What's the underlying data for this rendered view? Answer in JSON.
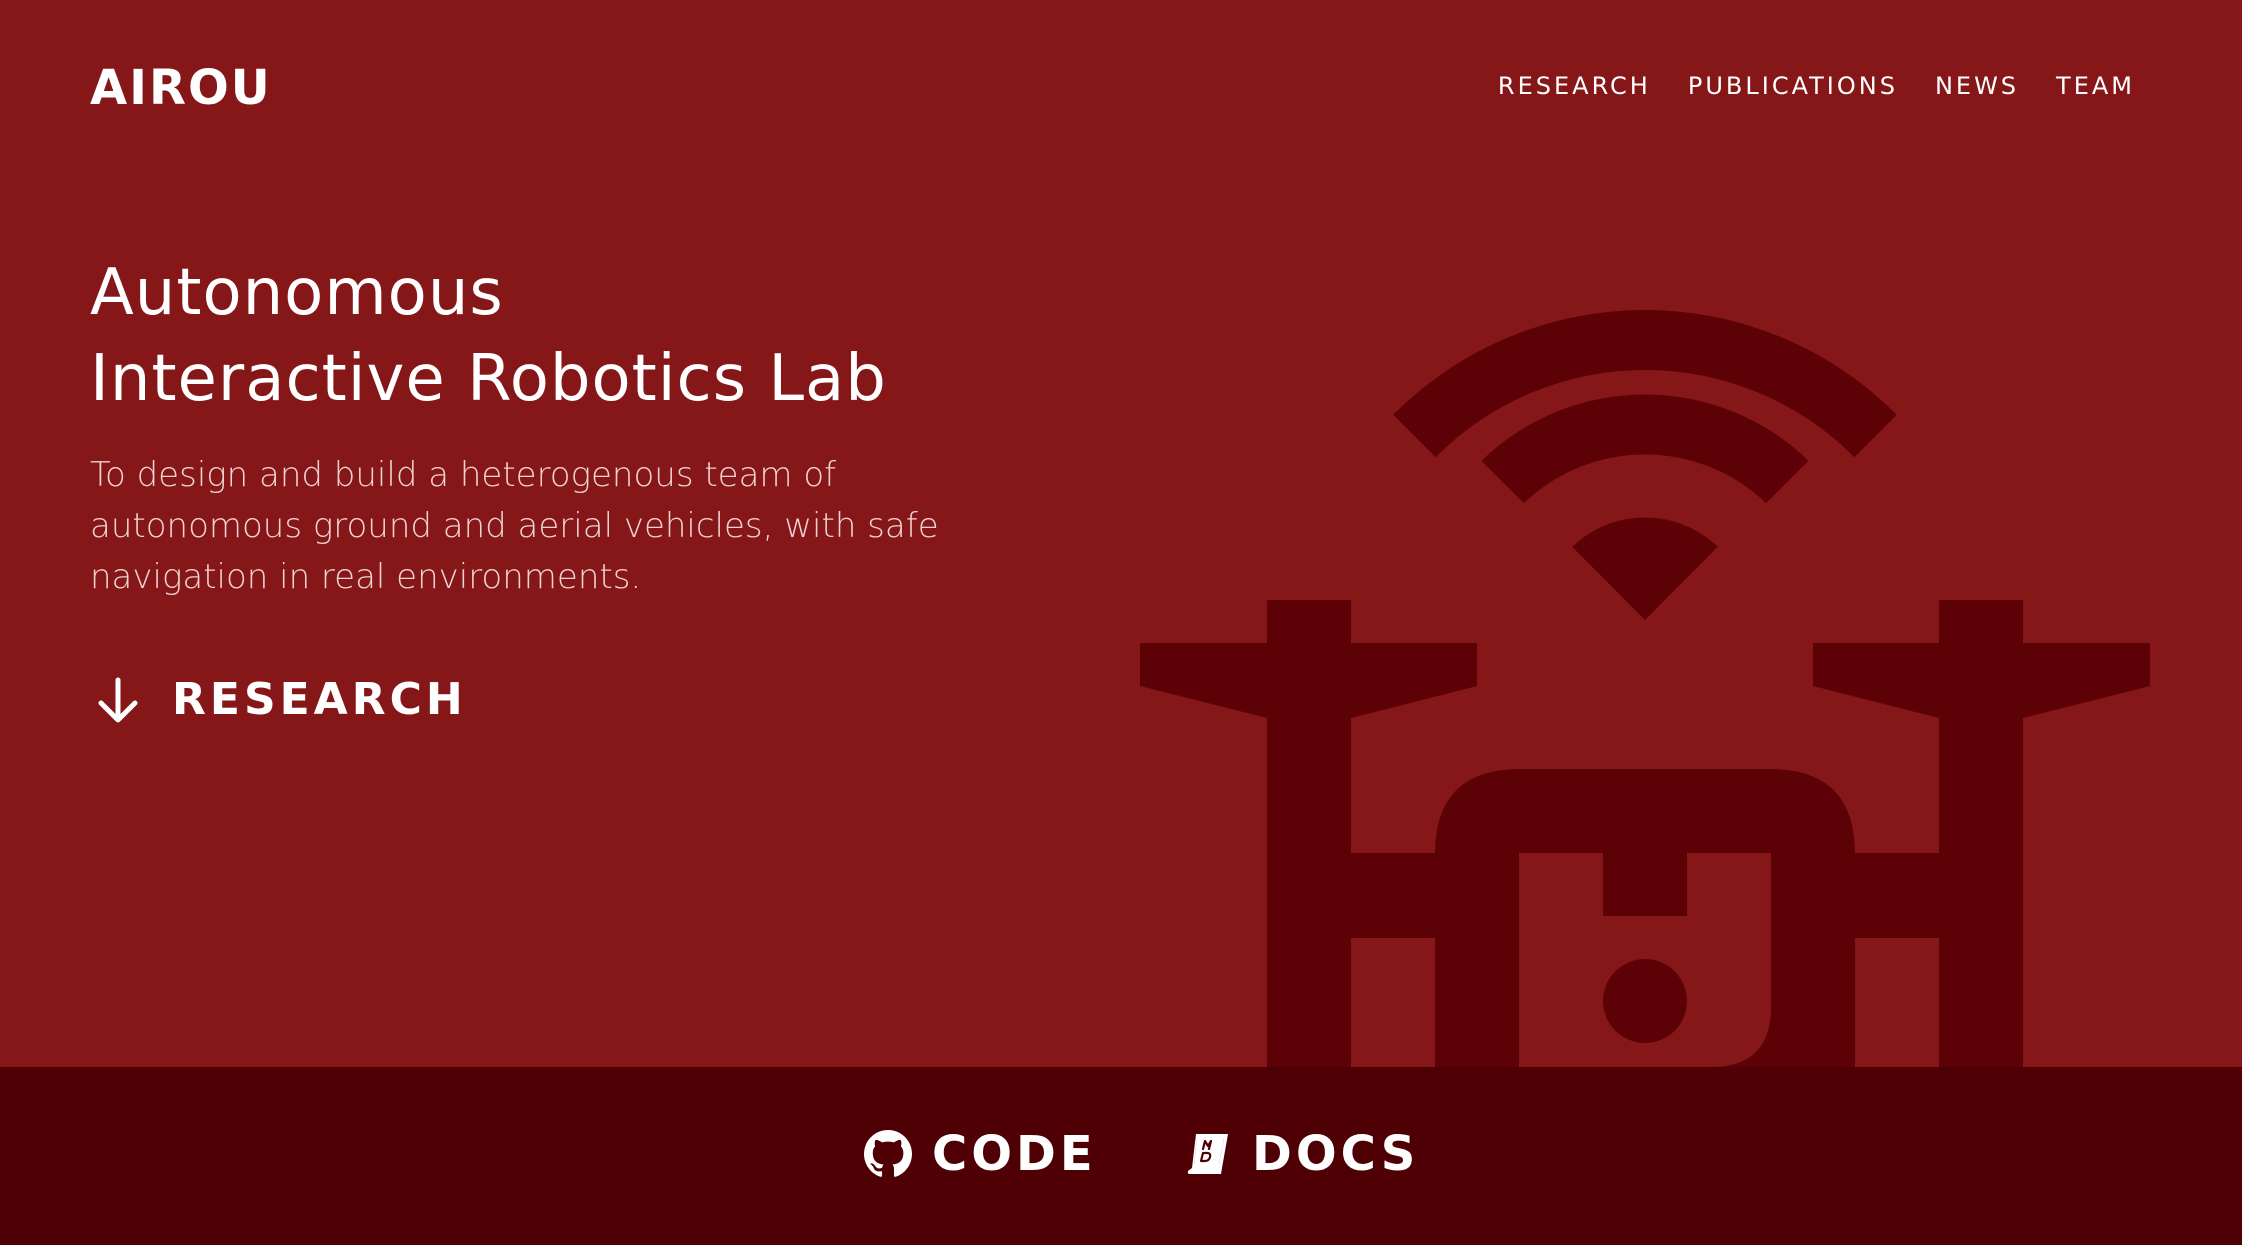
{
  "brand": {
    "logo": "AIROU"
  },
  "nav": {
    "items": [
      {
        "label": "RESEARCH"
      },
      {
        "label": "PUBLICATIONS"
      },
      {
        "label": "NEWS"
      },
      {
        "label": "TEAM"
      }
    ]
  },
  "hero": {
    "title_line1": "Autonomous",
    "title_line2": "Interactive Robotics Lab",
    "mission": "To design and build a heterogenous team of autonomous ground and aerial vehicles, with safe navigation in real environments.",
    "cta_label": "RESEARCH",
    "cta_icon": "arrow-down-icon",
    "illustration_icon": "drone-wifi-icon"
  },
  "footer": {
    "code_label": "CODE",
    "code_icon": "github-icon",
    "docs_label": "DOCS",
    "docs_icon": "markdown-book-icon"
  },
  "colors": {
    "hero_bg": "#861719",
    "illustration": "#5c0105",
    "footer_bg": "#4e0004",
    "text": "#ffffff"
  }
}
